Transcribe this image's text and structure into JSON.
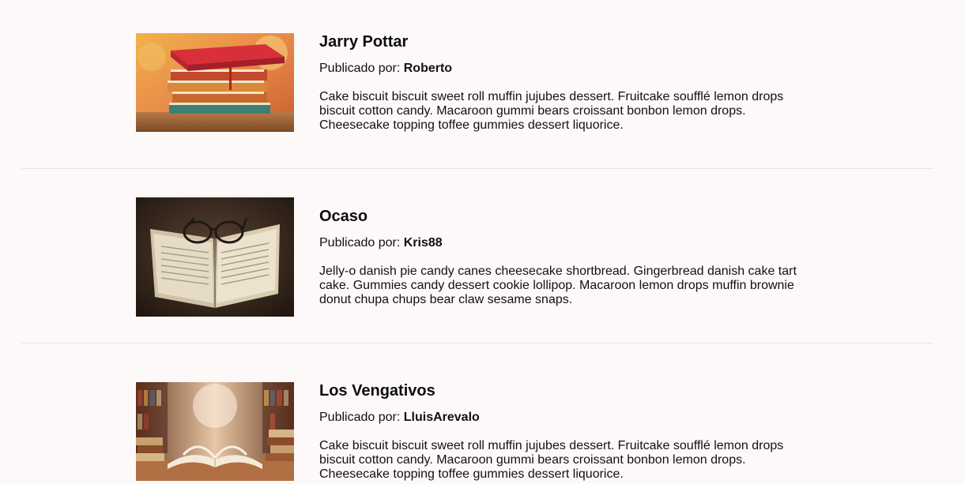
{
  "posts": [
    {
      "title": "Jarry Pottar",
      "byline_prefix": "Publicado por:",
      "author": "Roberto",
      "description": "Cake biscuit biscuit sweet roll muffin jujubes dessert. Fruitcake soufflé lemon drops biscuit cotton candy. Macaroon gummi bears croissant bonbon lemon drops. Cheesecake topping toffee gummies dessert liquorice.",
      "image": "stacked-books-image"
    },
    {
      "title": "Ocaso",
      "byline_prefix": "Publicado por:",
      "author": "Kris88",
      "description": "Jelly-o danish pie candy canes cheesecake shortbread. Gingerbread danish cake tart cake. Gummies candy dessert cookie lollipop. Macaroon lemon drops muffin brownie donut chupa chups bear claw sesame snaps.",
      "image": "open-book-glasses-image"
    },
    {
      "title": "Los Vengativos",
      "byline_prefix": "Publicado por:",
      "author": "LluisArevalo",
      "description": "Cake biscuit biscuit sweet roll muffin jujubes dessert. Fruitcake soufflé lemon drops biscuit cotton candy. Macaroon gummi bears croissant bonbon lemon drops. Cheesecake topping toffee gummies dessert liquorice.",
      "image": "library-open-book-image"
    }
  ]
}
